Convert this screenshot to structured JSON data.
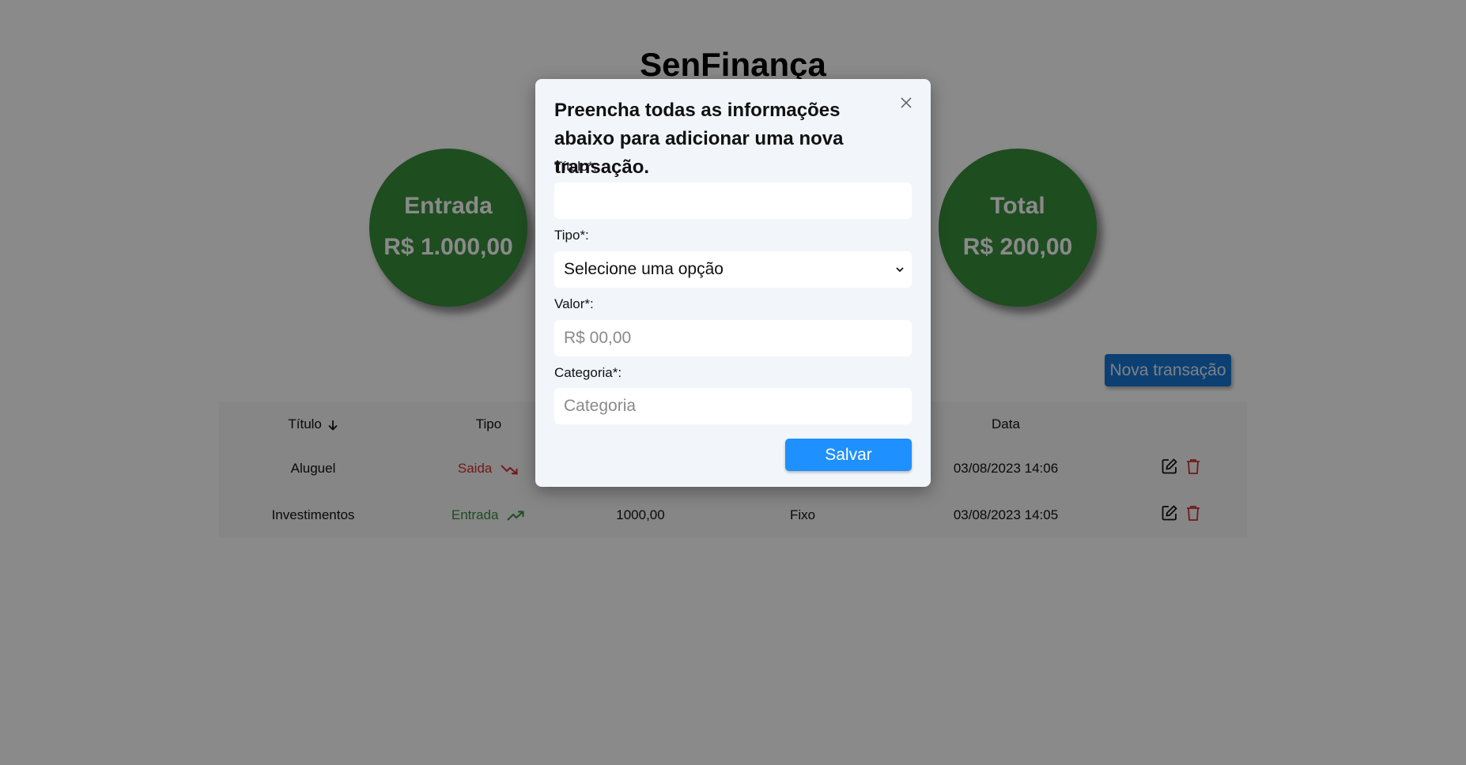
{
  "app": {
    "title": "SenFinança"
  },
  "summary": {
    "entrada": {
      "label": "Entrada",
      "value": "R$ 1.000,00"
    },
    "total": {
      "label": "Total",
      "value": "R$ 200,00"
    }
  },
  "actions": {
    "new_transaction": "Nova transação"
  },
  "table": {
    "headers": {
      "titulo": "Título",
      "tipo": "Tipo",
      "data": "Data"
    },
    "rows": [
      {
        "titulo": "Aluguel",
        "tipo": "Saida",
        "valor": "",
        "categoria": "",
        "data": "03/08/2023 14:06"
      },
      {
        "titulo": "Investimentos",
        "tipo": "Entrada",
        "valor": "1000,00",
        "categoria": "Fixo",
        "data": "03/08/2023 14:05"
      }
    ]
  },
  "modal": {
    "title": "Preencha todas as informações abaixo para adicionar uma nova transação.",
    "fields": {
      "titulo": {
        "label": "Título*:",
        "value": "",
        "placeholder": ""
      },
      "tipo": {
        "label": "Tipo*:",
        "selected": "Selecione uma opção"
      },
      "valor": {
        "label": "Valor*:",
        "value": "",
        "placeholder": "R$ 00,00"
      },
      "categoria": {
        "label": "Categoria*:",
        "value": "",
        "placeholder": "Categoria"
      }
    },
    "save": "Salvar"
  },
  "colors": {
    "circle": "#388e3c",
    "primary_button": "#1e90ff",
    "new_tx_button": "#1976d2",
    "saida": "#d32f2f",
    "entrada": "#388e3c"
  },
  "icons": [
    "arrow-down-icon",
    "trending-down-icon",
    "trending-up-icon",
    "edit-icon",
    "trash-icon",
    "close-icon",
    "chevron-down-icon"
  ]
}
